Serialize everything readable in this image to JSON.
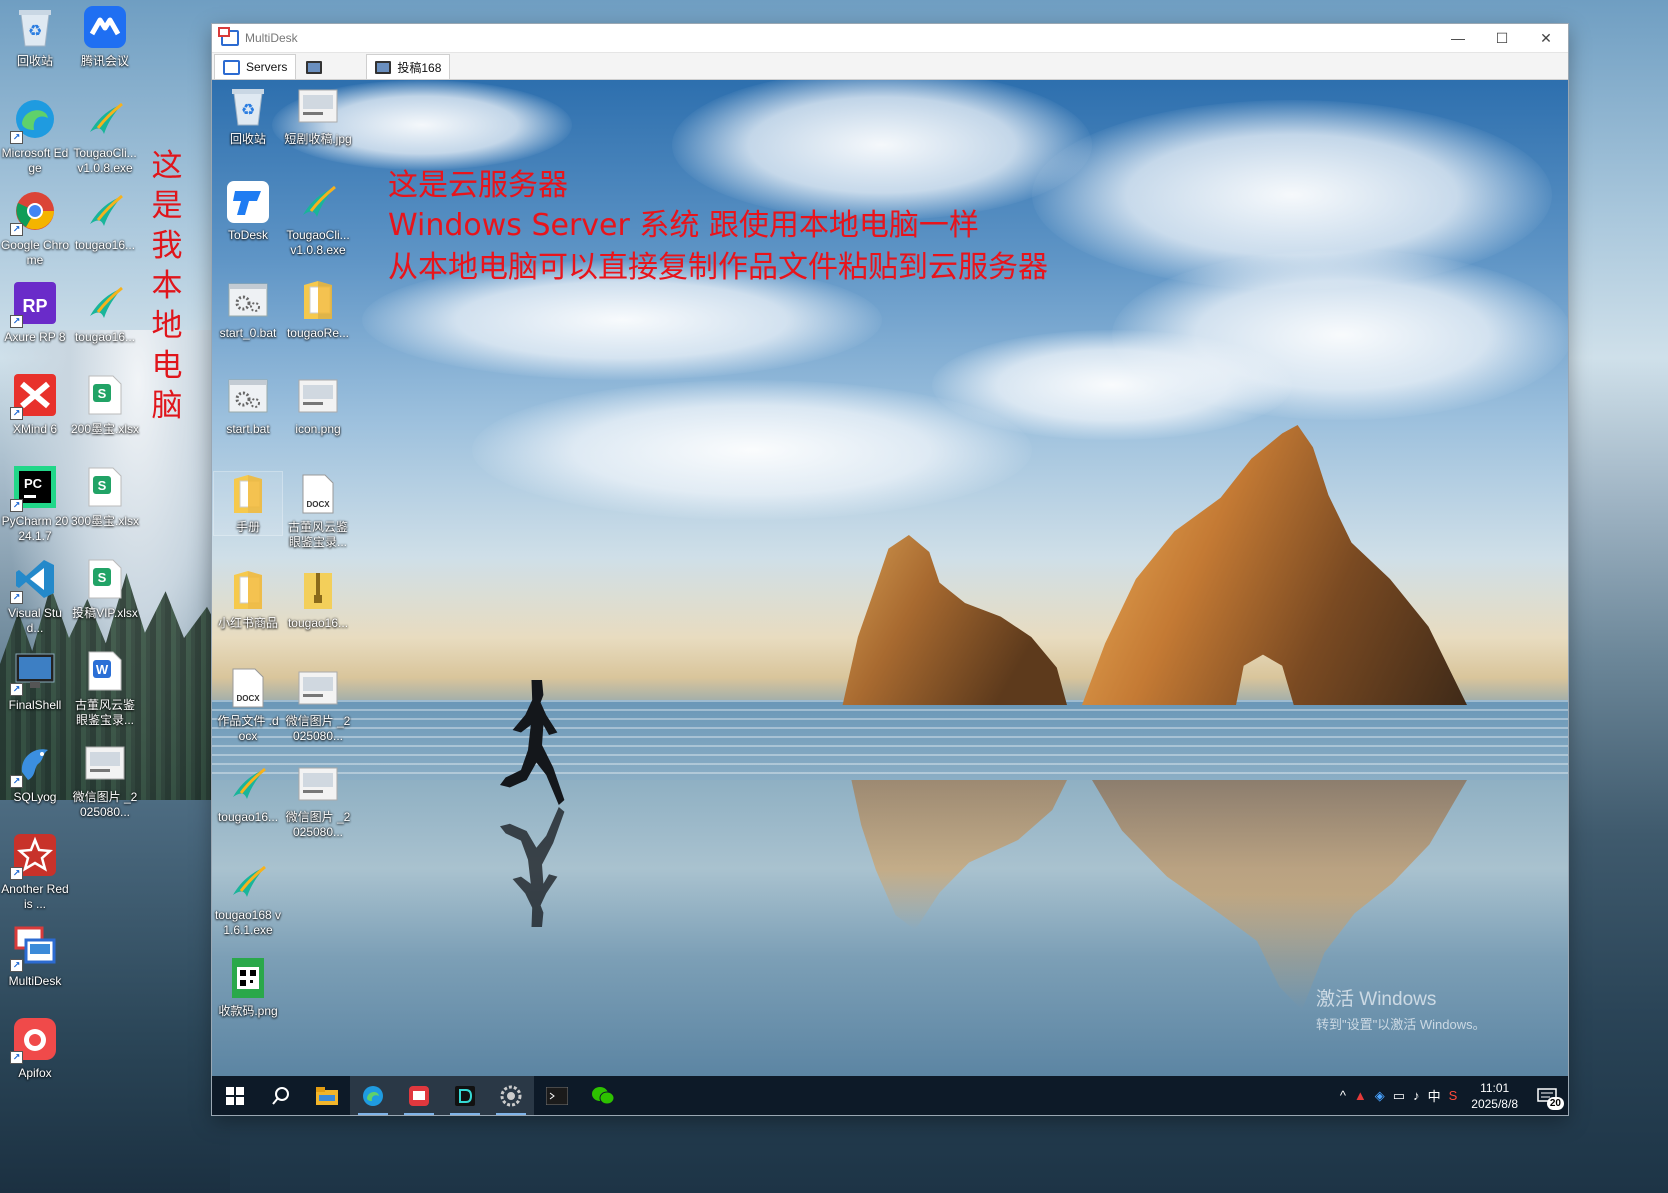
{
  "host_desktop": {
    "icons": [
      {
        "label": "回收站",
        "icon": "recycle-bin-icon"
      },
      {
        "label": "腾讯会议",
        "icon": "tencent-meeting-icon"
      },
      {
        "label": "Microsoft Edge",
        "icon": "edge-icon"
      },
      {
        "label": "TougaoCli... v1.0.8.exe",
        "icon": "tougao-icon"
      },
      {
        "label": "Google Chrome",
        "icon": "chrome-icon"
      },
      {
        "label": "tougao16...",
        "icon": "tougao-icon"
      },
      {
        "label": "Axure RP 8",
        "icon": "axure-icon"
      },
      {
        "label": "tougao16...",
        "icon": "tougao-icon"
      },
      {
        "label": "XMind 6",
        "icon": "xmind-icon"
      },
      {
        "label": "200墨宝.xlsx",
        "icon": "spreadsheet-icon"
      },
      {
        "label": "PyCharm 2024.1.7",
        "icon": "pycharm-icon"
      },
      {
        "label": "300墨宝.xlsx",
        "icon": "spreadsheet-icon"
      },
      {
        "label": "Visual Stud...",
        "icon": "vscode-icon"
      },
      {
        "label": "投稿VIP.xlsx",
        "icon": "spreadsheet-icon"
      },
      {
        "label": "FinalShell",
        "icon": "finalshell-icon"
      },
      {
        "label": "古董风云鉴 眼鉴宝录...",
        "icon": "word-doc-icon"
      },
      {
        "label": "SQLyog",
        "icon": "sqlyog-icon"
      },
      {
        "label": "微信图片 _2025080...",
        "icon": "image-file-icon"
      },
      {
        "label": "Another Redis ...",
        "icon": "redis-icon"
      },
      {
        "label": "MultiDesk",
        "icon": "multidesk-icon"
      },
      {
        "label": "Apifox",
        "icon": "apifox-icon"
      }
    ],
    "vertical_note": [
      "这",
      "是",
      "我",
      "本",
      "地",
      "电",
      "脑"
    ]
  },
  "window": {
    "title": "MultiDesk",
    "tabs": [
      {
        "label": "Servers"
      },
      {
        "label": ""
      },
      {
        "label": "投稿168"
      }
    ],
    "controls": {
      "minimize": "—",
      "maximize": "☐",
      "close": "✕"
    }
  },
  "remote_desktop": {
    "icons": [
      {
        "label": "回收站",
        "icon": "recycle-bin-icon"
      },
      {
        "label": "短剧收稿.jpg",
        "icon": "image-file-icon"
      },
      {
        "label": "ToDesk",
        "icon": "todesk-icon"
      },
      {
        "label": "TougaoCli... v1.0.8.exe",
        "icon": "tougao-icon"
      },
      {
        "label": "start_0.bat",
        "icon": "batch-file-icon"
      },
      {
        "label": "tougaoRe...",
        "icon": "folder-icon"
      },
      {
        "label": "start.bat",
        "icon": "batch-file-icon"
      },
      {
        "label": "icon.png",
        "icon": "image-file-icon"
      },
      {
        "label": "手册",
        "icon": "folder-icon"
      },
      {
        "label": "古董风云鉴 眼鉴宝录...",
        "icon": "docx-file-icon"
      },
      {
        "label": "小红书商品",
        "icon": "folder-icon"
      },
      {
        "label": "tougao16...",
        "icon": "zip-folder-icon"
      },
      {
        "label": "作品文件 .docx",
        "icon": "docx-file-icon"
      },
      {
        "label": "微信图片 _2025080...",
        "icon": "image-file-icon"
      },
      {
        "label": "tougao16...",
        "icon": "tougao-icon"
      },
      {
        "label": "微信图片 _2025080...",
        "icon": "image-file-icon"
      },
      {
        "label": "tougao168 v1.6.1.exe",
        "icon": "tougao-icon"
      },
      {
        "label": "收款码.png",
        "icon": "qr-image-icon"
      }
    ],
    "annotation_lines": [
      "这是云服务器",
      "Windows Server 系统 跟使用本地电脑一样",
      "从本地电脑可以直接复制作品文件粘贴到云服务器"
    ],
    "activation_watermark": {
      "line1": "激活 Windows",
      "line2": "转到\"设置\"以激活 Windows。"
    },
    "taskbar": {
      "apps": [
        "start-icon",
        "search-icon",
        "file-explorer-icon",
        "edge-icon",
        "app-red-icon",
        "app-dark-icon",
        "settings-gear-icon",
        "terminal-icon",
        "wechat-icon"
      ],
      "tray": {
        "chevron": "^",
        "ime": "中",
        "time": "11:01",
        "date": "2025/8/8",
        "notification_count": "20"
      }
    }
  },
  "colors": {
    "annotation_red": "#e8141b",
    "taskbar_bg": "#0d1a28"
  }
}
